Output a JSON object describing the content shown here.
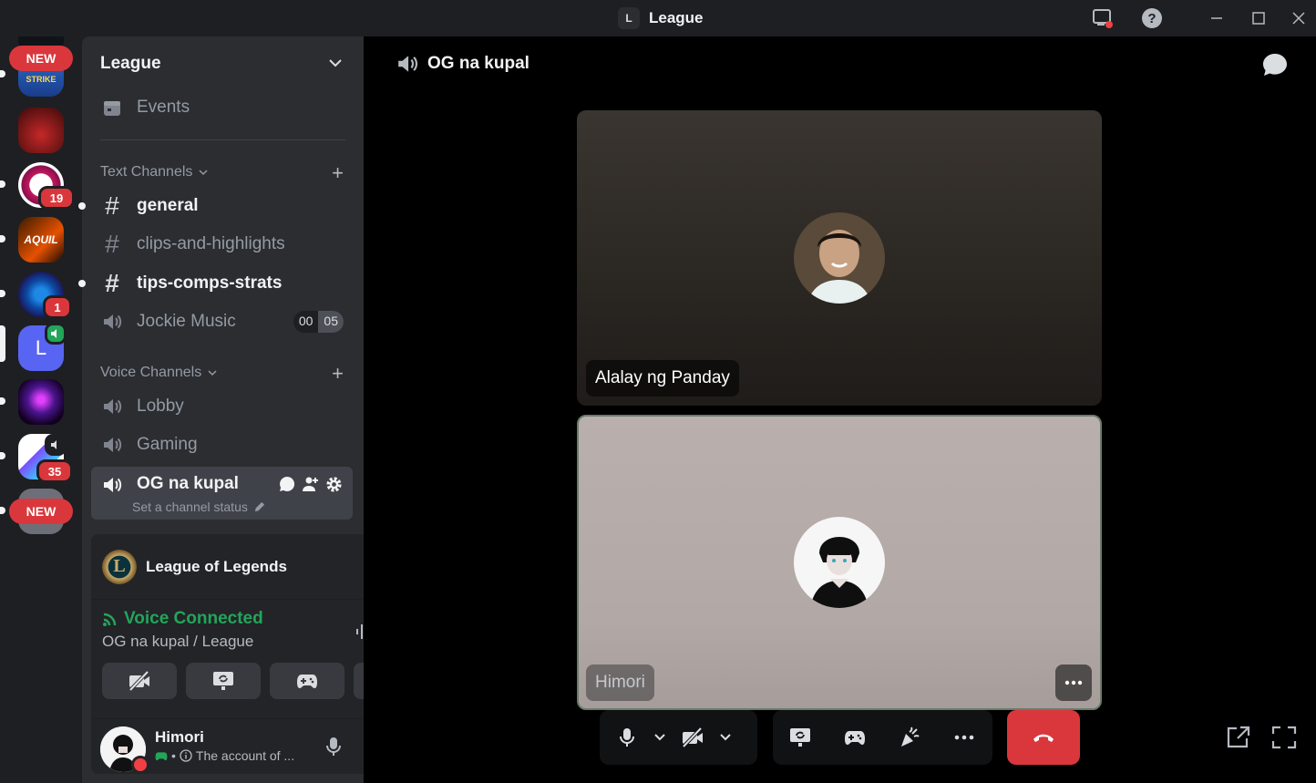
{
  "window": {
    "title": "League",
    "title_badge": "L"
  },
  "rail": {
    "new_label": "NEW",
    "servers": [
      {
        "badge": ""
      },
      {
        "badge": ""
      },
      {
        "badge": "19"
      },
      {
        "badge": ""
      },
      {
        "badge": "1"
      },
      {
        "initial": "L",
        "speaking": true
      },
      {
        "badge": ""
      },
      {
        "badge": "35"
      }
    ],
    "strike_text": "STRIKE",
    "aquil_text": "AQUIL"
  },
  "guild": {
    "name": "League",
    "events_label": "Events",
    "text_category": "Text Channels",
    "voice_category": "Voice Channels",
    "text_channels": [
      {
        "name": "general",
        "unread": true
      },
      {
        "name": "clips-and-highlights",
        "unread": false
      },
      {
        "name": "tips-comps-strats",
        "unread": true
      }
    ],
    "jockie": {
      "name": "Jockie Music",
      "tag_a": "00",
      "tag_b": "05"
    },
    "voice_channels": [
      {
        "name": "Lobby"
      },
      {
        "name": "Gaming"
      }
    ],
    "active_channel": {
      "name": "OG na kupal",
      "status": "Set a channel status"
    }
  },
  "panel": {
    "activity_name": "League of Legends",
    "voice_status": "Voice Connected",
    "voice_location": "OG na kupal / League",
    "user": {
      "name": "Himori",
      "status": "The account of ..."
    }
  },
  "stage": {
    "channel_name": "OG na kupal",
    "participants": [
      {
        "name": "Alalay ng Panday"
      },
      {
        "name": "Himori"
      }
    ]
  },
  "colors": {
    "accent_green": "#23a55a",
    "danger_red": "#da373c",
    "blurple": "#5865f2"
  }
}
